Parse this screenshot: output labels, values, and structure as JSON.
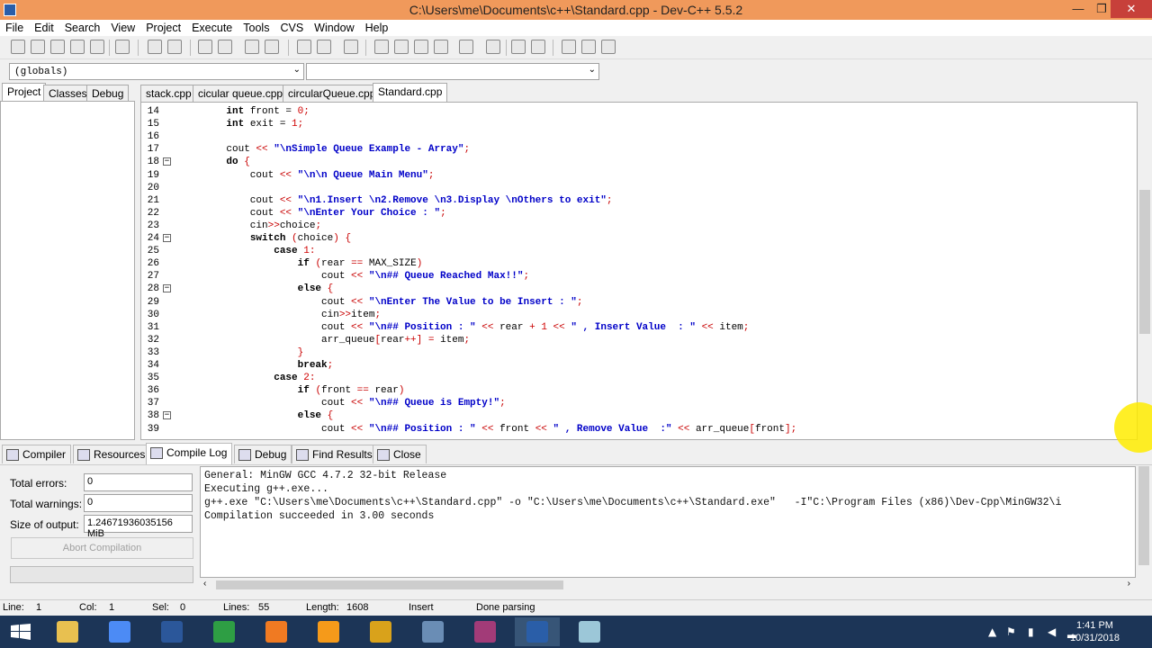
{
  "window": {
    "title": "C:\\Users\\me\\Documents\\c++\\Standard.cpp - Dev-C++ 5.5.2",
    "minimize": "—",
    "maximize": "❐",
    "close": "✕"
  },
  "menu": [
    "File",
    "Edit",
    "Search",
    "View",
    "Project",
    "Execute",
    "Tools",
    "CVS",
    "Window",
    "Help"
  ],
  "combos": {
    "scope": "(globals)",
    "member": ""
  },
  "left_tabs": [
    "Project",
    "Classes",
    "Debug"
  ],
  "file_tabs": [
    "stack.cpp",
    "cicular queue.cpp",
    "circularQueue.cpp",
    "Standard.cpp"
  ],
  "code_lines": [
    {
      "n": "14",
      "html": "    <span class='kw'>int</span> front = <span class='num'>0</span><span class='op'>;</span>"
    },
    {
      "n": "15",
      "html": "    <span class='kw'>int</span> exit = <span class='num'>1</span><span class='op'>;</span>"
    },
    {
      "n": "16",
      "html": ""
    },
    {
      "n": "17",
      "html": "    cout <span class='op'>&lt;&lt;</span> <span class='st'>\"\\nSimple Queue Example - Array\"</span><span class='op'>;</span>"
    },
    {
      "n": "18",
      "html": "    <span class='kw'>do</span> <span class='op'>{</span>",
      "fold": "−"
    },
    {
      "n": "19",
      "html": "        cout <span class='op'>&lt;&lt;</span> <span class='st'>\"\\n\\n Queue Main Menu\"</span><span class='op'>;</span>"
    },
    {
      "n": "20",
      "html": ""
    },
    {
      "n": "21",
      "html": "        cout <span class='op'>&lt;&lt;</span> <span class='st'>\"\\n1.Insert \\n2.Remove \\n3.Display \\nOthers to exit\"</span><span class='op'>;</span>"
    },
    {
      "n": "22",
      "html": "        cout <span class='op'>&lt;&lt;</span> <span class='st'>\"\\nEnter Your Choice : \"</span><span class='op'>;</span>"
    },
    {
      "n": "23",
      "html": "        cin<span class='op'>&gt;&gt;</span>choice<span class='op'>;</span>"
    },
    {
      "n": "24",
      "html": "        <span class='kw'>switch</span> <span class='op'>(</span>choice<span class='op'>)</span> <span class='op'>{</span>",
      "fold": "−"
    },
    {
      "n": "25",
      "html": "            <span class='kw'>case</span> <span class='num'>1</span><span class='op'>:</span>"
    },
    {
      "n": "26",
      "html": "                <span class='kw'>if</span> <span class='op'>(</span>rear <span class='op'>==</span> MAX_SIZE<span class='op'>)</span>"
    },
    {
      "n": "27",
      "html": "                    cout <span class='op'>&lt;&lt;</span> <span class='st'>\"\\n## Queue Reached Max!!\"</span><span class='op'>;</span>"
    },
    {
      "n": "28",
      "html": "                <span class='kw'>else</span> <span class='op'>{</span>",
      "fold": "−"
    },
    {
      "n": "29",
      "html": "                    cout <span class='op'>&lt;&lt;</span> <span class='st'>\"\\nEnter The Value to be Insert : \"</span><span class='op'>;</span>"
    },
    {
      "n": "30",
      "html": "                    cin<span class='op'>&gt;&gt;</span>item<span class='op'>;</span>"
    },
    {
      "n": "31",
      "html": "                    cout <span class='op'>&lt;&lt;</span> <span class='st'>\"\\n## Position : \"</span> <span class='op'>&lt;&lt;</span> rear <span class='op'>+</span> <span class='num'>1</span> <span class='op'>&lt;&lt;</span> <span class='st'>\" , Insert Value  : \"</span> <span class='op'>&lt;&lt;</span> item<span class='op'>;</span>"
    },
    {
      "n": "32",
      "html": "                    arr_queue<span class='op'>[</span>rear<span class='op'>++]</span> <span class='op'>=</span> item<span class='op'>;</span>"
    },
    {
      "n": "33",
      "html": "                <span class='op'>}</span>",
      "foldend": true
    },
    {
      "n": "34",
      "html": "                <span class='kw'>break</span><span class='op'>;</span>"
    },
    {
      "n": "35",
      "html": "            <span class='kw'>case</span> <span class='num'>2</span><span class='op'>:</span>"
    },
    {
      "n": "36",
      "html": "                <span class='kw'>if</span> <span class='op'>(</span>front <span class='op'>==</span> rear<span class='op'>)</span>"
    },
    {
      "n": "37",
      "html": "                    cout <span class='op'>&lt;&lt;</span> <span class='st'>\"\\n## Queue is Empty!\"</span><span class='op'>;</span>"
    },
    {
      "n": "38",
      "html": "                <span class='kw'>else</span> <span class='op'>{</span>",
      "fold": "−"
    },
    {
      "n": "39",
      "html": "                    cout <span class='op'>&lt;&lt;</span> <span class='st'>\"\\n## Position : \"</span> <span class='op'>&lt;&lt;</span> front <span class='op'>&lt;&lt;</span> <span class='st'>\" , Remove Value  :\"</span> <span class='op'>&lt;&lt;</span> arr_queue<span class='op'>[</span>front<span class='op'>]</span><span class='op'>;</span>"
    }
  ],
  "bottom_tabs": [
    "Compiler",
    "Resources",
    "Compile Log",
    "Debug",
    "Find Results",
    "Close"
  ],
  "compile_stats": {
    "errors_label": "Total errors:",
    "errors": "0",
    "warnings_label": "Total warnings:",
    "warnings": "0",
    "size_label": "Size of output:",
    "size": "1.24671936035156 MiB",
    "abort_label": "Abort Compilation"
  },
  "log_lines": [
    "General: MinGW GCC 4.7.2 32-bit Release",
    "Executing g++.exe...",
    "g++.exe \"C:\\Users\\me\\Documents\\c++\\Standard.cpp\" -o \"C:\\Users\\me\\Documents\\c++\\Standard.exe\"   -I\"C:\\Program Files (x86)\\Dev-Cpp\\MinGW32\\i",
    "Compilation succeeded in 3.00 seconds"
  ],
  "status": {
    "line_label": "Line:",
    "line": "1",
    "col_label": "Col:",
    "col": "1",
    "sel_label": "Sel:",
    "sel": "0",
    "lines_label": "Lines:",
    "lines": "55",
    "length_label": "Length:",
    "length": "1608",
    "mode": "Insert",
    "state": "Done parsing"
  },
  "taskbar": {
    "time": "1:41 PM",
    "date": "10/31/2018",
    "apps": [
      {
        "name": "file-explorer-icon",
        "color": "#e8c050"
      },
      {
        "name": "chrome-icon",
        "color": "#4c8bf5"
      },
      {
        "name": "word-icon",
        "color": "#2b579a"
      },
      {
        "name": "draw-app-icon",
        "color": "#2e9e44"
      },
      {
        "name": "firefox-icon",
        "color": "#f07a22"
      },
      {
        "name": "sublime-icon",
        "color": "#f59a1a"
      },
      {
        "name": "star-app-icon",
        "color": "#d9a21b"
      },
      {
        "name": "virtualbox-icon",
        "color": "#6a8db5"
      },
      {
        "name": "winrar-icon",
        "color": "#a23b78"
      },
      {
        "name": "devcpp-icon",
        "color": "#2a5ea8"
      },
      {
        "name": "notepad-icon",
        "color": "#9cc7d8"
      }
    ]
  }
}
